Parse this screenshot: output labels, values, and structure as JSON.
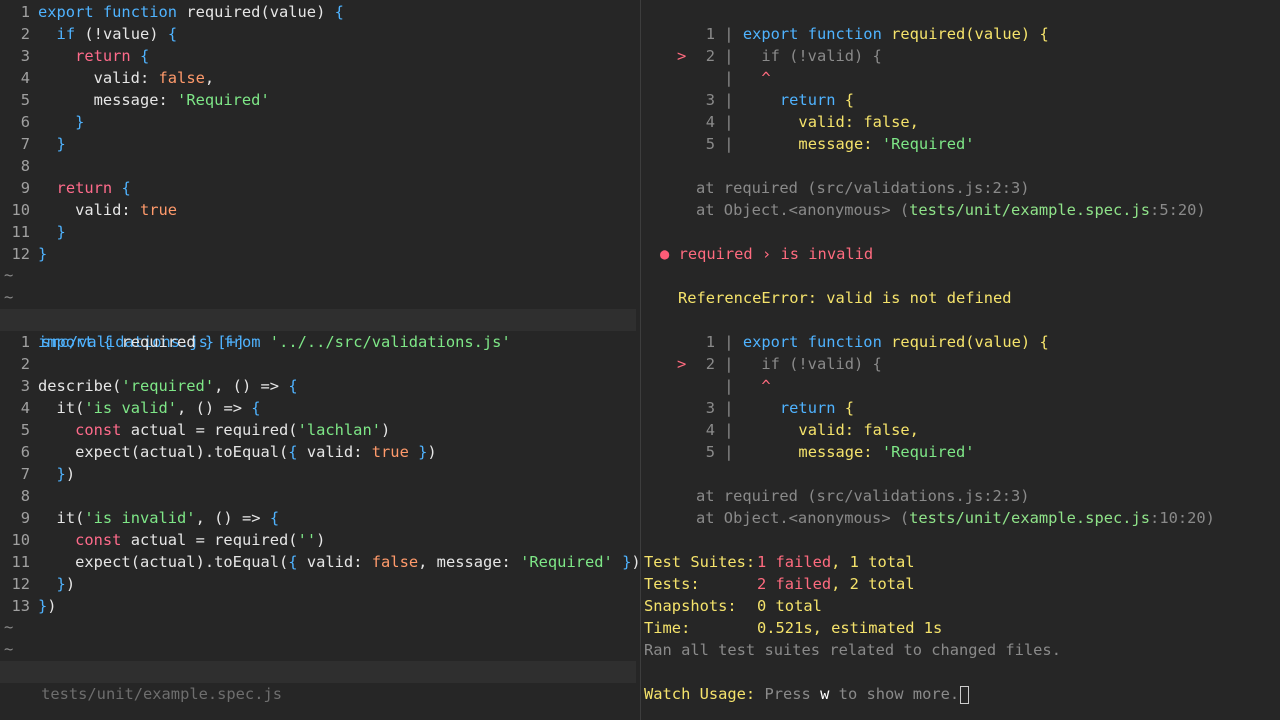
{
  "editor": {
    "top_file": {
      "lines": [
        {
          "num": "1",
          "code": "export function required(value) {"
        },
        {
          "num": "2",
          "code": "  if (!value) {"
        },
        {
          "num": "3",
          "code": "    return {"
        },
        {
          "num": "4",
          "code": "      valid: false,"
        },
        {
          "num": "5",
          "code": "      message: 'Required'"
        },
        {
          "num": "6",
          "code": "    }"
        },
        {
          "num": "7",
          "code": "  }"
        },
        {
          "num": "8",
          "code": ""
        },
        {
          "num": "9",
          "code": "  return {"
        },
        {
          "num": "10",
          "code": "    valid: true"
        },
        {
          "num": "11",
          "code": "  }"
        },
        {
          "num": "12",
          "code": "}"
        }
      ],
      "status": "src/validations.js [+]"
    },
    "bottom_file": {
      "lines": [
        {
          "num": "1",
          "code": "import { required } from '../../src/validations.js'"
        },
        {
          "num": "2",
          "code": ""
        },
        {
          "num": "3",
          "code": "describe('required', () => {"
        },
        {
          "num": "4",
          "code": "  it('is valid', () => {"
        },
        {
          "num": "5",
          "code": "    const actual = required('lachlan')"
        },
        {
          "num": "6",
          "code": "    expect(actual).toEqual({ valid: true })"
        },
        {
          "num": "7",
          "code": "  })"
        },
        {
          "num": "8",
          "code": ""
        },
        {
          "num": "9",
          "code": "  it('is invalid', () => {"
        },
        {
          "num": "10",
          "code": "    const actual = required('')"
        },
        {
          "num": "11",
          "code": "    expect(actual).toEqual({ valid: false, message: 'Required' })"
        },
        {
          "num": "12",
          "code": "  })"
        },
        {
          "num": "13",
          "code": "})"
        }
      ],
      "status": "tests/unit/example.spec.js"
    },
    "tilde": "~"
  },
  "terminal": {
    "block1": {
      "snippet": [
        {
          "marker": "",
          "num": "1",
          "code": "export function required(value) {"
        },
        {
          "marker": ">",
          "num": "2",
          "code": "  if (!valid) {"
        },
        {
          "marker": "",
          "num": "",
          "code": "  ^"
        },
        {
          "marker": "",
          "num": "3",
          "code": "    return {"
        },
        {
          "marker": "",
          "num": "4",
          "code": "      valid: false,"
        },
        {
          "marker": "",
          "num": "5",
          "code": "      message: 'Required'"
        }
      ],
      "trace1": "at required (src/validations.js:2:3)",
      "trace2_prefix": "at Object.<anonymous> (",
      "trace2_file": "tests/unit/example.spec.js",
      "trace2_suffix": ":5:20)"
    },
    "failure_title": "required › is invalid",
    "error_message": "ReferenceError: valid is not defined",
    "block2": {
      "snippet": [
        {
          "marker": "",
          "num": "1",
          "code": "export function required(value) {"
        },
        {
          "marker": ">",
          "num": "2",
          "code": "  if (!valid) {"
        },
        {
          "marker": "",
          "num": "",
          "code": "  ^"
        },
        {
          "marker": "",
          "num": "3",
          "code": "    return {"
        },
        {
          "marker": "",
          "num": "4",
          "code": "      valid: false,"
        },
        {
          "marker": "",
          "num": "5",
          "code": "      message: 'Required'"
        }
      ],
      "trace1": "at required (src/validations.js:2:3)",
      "trace2_prefix": "at Object.<anonymous> (",
      "trace2_file": "tests/unit/example.spec.js",
      "trace2_suffix": ":10:20)"
    },
    "summary": {
      "suites_label": "Test Suites:",
      "suites_failed": "1 failed",
      "suites_total": ", 1 total",
      "tests_label": "Tests:",
      "tests_failed": "2 failed",
      "tests_total": ", 2 total",
      "snapshots_label": "Snapshots:",
      "snapshots_value": "0 total",
      "time_label": "Time:",
      "time_value": "0.521s, estimated 1s",
      "ran_all": "Ran all test suites related to changed files."
    },
    "watch": {
      "label": "Watch Usage:",
      "press": "Press",
      "key": "w",
      "rest": "to show more."
    }
  }
}
